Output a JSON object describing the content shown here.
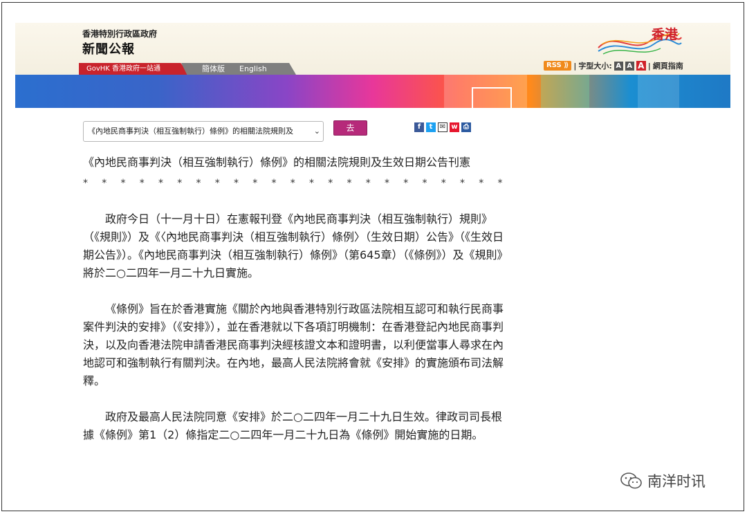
{
  "header": {
    "gov_name": "香港特別行政區政府",
    "site_name": "新聞公報",
    "logo_text": "香港",
    "govhk_tab": "GovHK 香港政府一站通",
    "lang_simplified": "簡体版",
    "lang_english": "English",
    "rss_label": "RSS",
    "font_size_label": "字型大小:",
    "font_a_small": "A",
    "font_a_medium": "A",
    "font_a_large": "A",
    "sitemap_label": "網頁指南"
  },
  "nav": {
    "select_value": "《內地民商事判決（相互強制執行）條例》的相關法院規則及",
    "go_label": "去"
  },
  "share_icons": [
    "facebook-icon",
    "twitter-icon",
    "email-icon",
    "weibo-icon",
    "print-icon"
  ],
  "article": {
    "title": "《內地民商事判決（相互強制執行）條例》的相關法院規則及生效日期公告刊憲",
    "stars": "* * * * * * * * * * * * * * * * * * * * * * * * * * * * * * * * * * * * *",
    "paragraphs": [
      "政府今日（十一月十日）在憲報刊登《內地民商事判決（相互強制執行）規則》（《規則》）及《〈內地民商事判決（相互強制執行）條例〉（生效日期）公告》（《生效日期公告》）。《內地民商事判決（相互強制執行）條例》（第645章）（《條例》）及《規則》將於二○二四年一月二十九日實施。",
      "《條例》旨在於香港實施《關於內地與香港特別行政區法院相互認可和執行民商事案件判決的安排》（《安排》），並在香港就以下各項訂明機制：在香港登記內地民商事判決，以及向香港法院申請香港民商事判決經核證文本和證明書，以利便當事人尋求在內地認可和強制執行有關判決。在內地，最高人民法院將會就《安排》的實施頒布司法解釋。",
      "政府及最高人民法院同意《安排》於二○二四年一月二十九日生效。律政司司長根據《條例》第1（2）條指定二○二四年一月二十九日為《條例》開始實施的日期。"
    ]
  },
  "watermark": {
    "text": "南洋时讯"
  },
  "colors": {
    "govhk_red": "#c9232c",
    "go_button": "#b62a7a",
    "rss_orange": "#f08a1c"
  }
}
